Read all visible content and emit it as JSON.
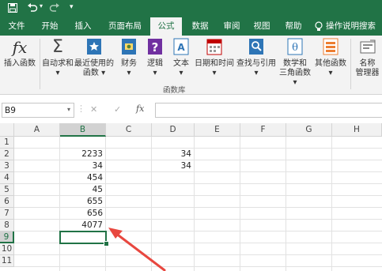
{
  "qat": {
    "save_icon": "save-icon",
    "undo_icon": "undo-icon",
    "redo_icon": "redo-icon",
    "customize_icon": "dropdown-icon"
  },
  "tabs": [
    {
      "label": "文件"
    },
    {
      "label": "开始"
    },
    {
      "label": "插入"
    },
    {
      "label": "页面布局"
    },
    {
      "label": "公式",
      "active": true
    },
    {
      "label": "数据"
    },
    {
      "label": "审阅"
    },
    {
      "label": "视图"
    },
    {
      "label": "帮助"
    },
    {
      "label": "操作说明搜索"
    }
  ],
  "ribbon": {
    "insert_function": "插入函数",
    "autosum": "自动求和",
    "recent_line1": "最近使用的",
    "recent_line2": "函数",
    "financial": "财务",
    "logical": "逻辑",
    "text": "文本",
    "datetime": "日期和时间",
    "lookup": "查找与引用",
    "math_line1": "数学和",
    "math_line2": "三角函数",
    "more": "其他函数",
    "names_line1": "名称",
    "names_line2": "管理器",
    "group_label": "函数库",
    "caret": "▾"
  },
  "formula_bar": {
    "name_box": "B9",
    "cancel": "✕",
    "enter": "✓",
    "fx": "fx",
    "value": ""
  },
  "columns": [
    "A",
    "B",
    "C",
    "D",
    "E",
    "F",
    "G",
    "H"
  ],
  "rows": [
    "1",
    "2",
    "3",
    "4",
    "5",
    "6",
    "7",
    "8",
    "9",
    "10",
    "11"
  ],
  "cells": {
    "B2": "2233",
    "D2": "34",
    "B3": "34",
    "D3": "34",
    "B4": "454",
    "B5": "45",
    "B6": "655",
    "B7": "656",
    "B8": "4077"
  },
  "selected_cell": "B9",
  "colors": {
    "accent": "#217346",
    "arrow": "#e8473f"
  }
}
